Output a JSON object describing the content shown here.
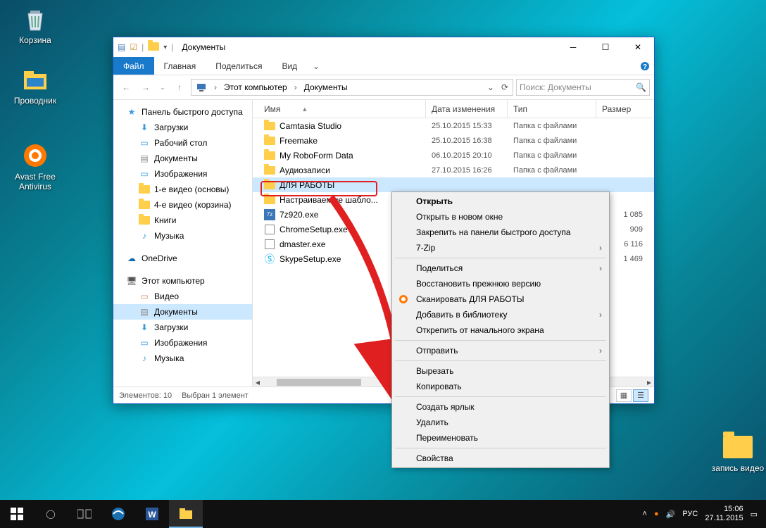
{
  "desktop": {
    "icons": [
      {
        "id": "recycle-bin",
        "label": "Корзина"
      },
      {
        "id": "explorer",
        "label": "Проводник"
      },
      {
        "id": "avast",
        "label": "Avast Free Antivirus"
      },
      {
        "id": "video-folder",
        "label": "запись видео"
      }
    ]
  },
  "window": {
    "title": "Документы",
    "tabs": {
      "file": "Файл",
      "home": "Главная",
      "share": "Поделиться",
      "view": "Вид"
    },
    "breadcrumbs": [
      "Этот компьютер",
      "Документы"
    ],
    "search_placeholder": "Поиск: Документы",
    "columns": {
      "name": "Имя",
      "date": "Дата изменения",
      "type": "Тип",
      "size": "Размер"
    },
    "sidebar": {
      "quick_access": "Панель быстрого доступа",
      "downloads": "Загрузки",
      "desktop": "Рабочий стол",
      "documents": "Документы",
      "pictures": "Изображения",
      "v1": "1-е видео (основы)",
      "v4": "4-е видео (корзина)",
      "books": "Книги",
      "music": "Музыка",
      "onedrive": "OneDrive",
      "this_pc": "Этот компьютер",
      "video": "Видео",
      "documents2": "Документы",
      "downloads2": "Загрузки",
      "pictures2": "Изображения",
      "music2": "Музыка"
    },
    "rows": [
      {
        "name": "Camtasia Studio",
        "date": "25.10.2015 15:33",
        "type": "Папка с файлами",
        "size": "",
        "icon": "folder",
        "sel": false
      },
      {
        "name": "Freemake",
        "date": "25.10.2015 16:38",
        "type": "Папка с файлами",
        "size": "",
        "icon": "folder",
        "sel": false
      },
      {
        "name": "My RoboForm Data",
        "date": "06.10.2015 20:10",
        "type": "Папка с файлами",
        "size": "",
        "icon": "folder",
        "sel": false
      },
      {
        "name": "Аудиозаписи",
        "date": "27.10.2015 16:26",
        "type": "Папка с файлами",
        "size": "",
        "icon": "folder",
        "sel": false
      },
      {
        "name": "ДЛЯ РАБОТЫ",
        "date": "",
        "type": "",
        "size": "",
        "icon": "folder",
        "sel": true
      },
      {
        "name": "Настраиваемые шабло...",
        "date": "",
        "type": "",
        "size": "",
        "icon": "folder",
        "sel": false
      },
      {
        "name": "7z920.exe",
        "date": "",
        "type": "",
        "size": "1 085",
        "icon": "7z",
        "sel": false
      },
      {
        "name": "ChromeSetup.exe",
        "date": "",
        "type": "",
        "size": "909",
        "icon": "app",
        "sel": false
      },
      {
        "name": "dmaster.exe",
        "date": "",
        "type": "",
        "size": "6 116",
        "icon": "app",
        "sel": false
      },
      {
        "name": "SkypeSetup.exe",
        "date": "",
        "type": "",
        "size": "1 469",
        "icon": "skype",
        "sel": false
      }
    ],
    "status": {
      "items": "Элементов: 10",
      "selected": "Выбран 1 элемент"
    }
  },
  "context_menu": {
    "items": [
      {
        "label": "Открыть",
        "bold": true
      },
      {
        "label": "Открыть в новом окне"
      },
      {
        "label": "Закрепить на панели быстрого доступа"
      },
      {
        "label": "7-Zip",
        "submenu": true
      },
      {
        "sep": true
      },
      {
        "label": "Поделиться",
        "submenu": true
      },
      {
        "label": "Восстановить прежнюю версию"
      },
      {
        "label": "Сканировать ДЛЯ РАБОТЫ",
        "icon": "avast"
      },
      {
        "label": "Добавить в библиотеку",
        "submenu": true
      },
      {
        "label": "Открепить от начального экрана"
      },
      {
        "sep": true
      },
      {
        "label": "Отправить",
        "submenu": true
      },
      {
        "sep": true
      },
      {
        "label": "Вырезать"
      },
      {
        "label": "Копировать"
      },
      {
        "sep": true
      },
      {
        "label": "Создать ярлык",
        "highlight": true
      },
      {
        "label": "Удалить"
      },
      {
        "label": "Переименовать"
      },
      {
        "sep": true
      },
      {
        "label": "Свойства"
      }
    ]
  },
  "taskbar": {
    "lang": "РУС",
    "time": "15:06",
    "date": "27.11.2015"
  }
}
